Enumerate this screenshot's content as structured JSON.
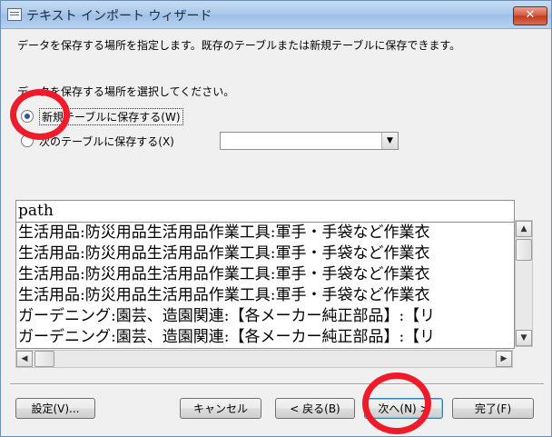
{
  "window": {
    "title": "テキスト インポート ウィザード",
    "close_glyph": "✕"
  },
  "description": "データを保存する場所を指定します。既存のテーブルまたは新規テーブルに保存できます。",
  "prompt": "データを保存する場所を選択してください。",
  "options": {
    "new_table": {
      "label": "新規テーブルに保存する(W)",
      "selected": true
    },
    "existing_table": {
      "label": "次のテーブルに保存する(X)",
      "selected": false,
      "combo_value": ""
    }
  },
  "preview": {
    "header": "path",
    "rows": [
      "生活用品:防災用品生活用品作業工具:軍手・手袋など作業衣",
      "生活用品:防災用品生活用品作業工具:軍手・手袋など作業衣",
      "生活用品:防災用品生活用品作業工具:軍手・手袋など作業衣",
      "生活用品:防災用品生活用品作業工具:軍手・手袋など作業衣",
      "ガーデニング:園芸、造園関連:【各メーカー純正部品】:【リ",
      "ガーデニング:園芸、造園関連:【各メーカー純正部品】:【リ"
    ]
  },
  "buttons": {
    "settings": "設定(V)...",
    "cancel": "キャンセル",
    "back": "< 戻る(B)",
    "next": "次へ(N) >",
    "finish": "完了(F)"
  },
  "colors": {
    "annotation": "#ee1c2b",
    "default_button_border": "#3c7fb1"
  }
}
